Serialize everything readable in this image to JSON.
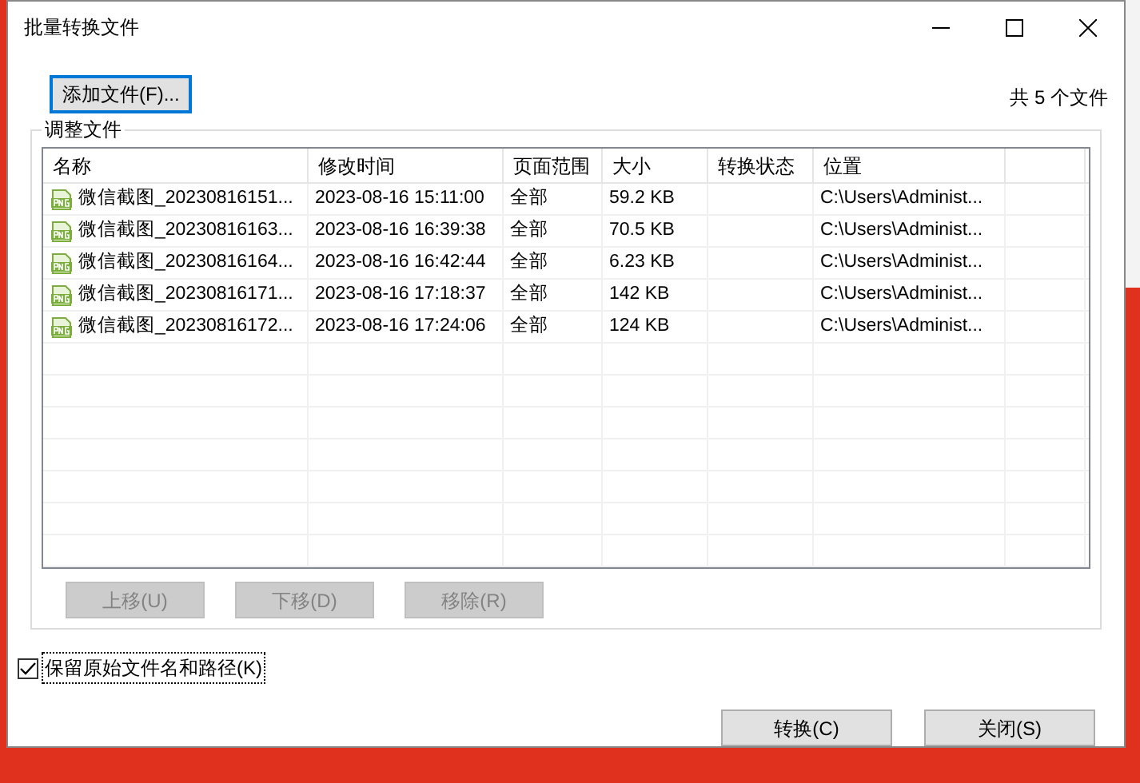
{
  "window": {
    "title": "批量转换文件"
  },
  "add_button": {
    "label": "添加文件(F)..."
  },
  "file_count": "共 5 个文件",
  "group": {
    "title": "调整文件"
  },
  "table": {
    "columns": [
      "名称",
      "修改时间",
      "页面范围",
      "大小",
      "转换状态",
      "位置"
    ],
    "rows": [
      {
        "name": "微信截图_20230816151...",
        "modified": "2023-08-16 15:11:00",
        "pages": "全部",
        "size": "59.2 KB",
        "location": "C:\\Users\\Administ..."
      },
      {
        "name": "微信截图_20230816163...",
        "modified": "2023-08-16 16:39:38",
        "pages": "全部",
        "size": "70.5 KB",
        "location": "C:\\Users\\Administ..."
      },
      {
        "name": "微信截图_20230816164...",
        "modified": "2023-08-16 16:42:44",
        "pages": "全部",
        "size": "6.23 KB",
        "location": "C:\\Users\\Administ..."
      },
      {
        "name": "微信截图_20230816171...",
        "modified": "2023-08-16 17:18:37",
        "pages": "全部",
        "size": "142 KB",
        "location": "C:\\Users\\Administ..."
      },
      {
        "name": "微信截图_20230816172...",
        "modified": "2023-08-16 17:24:06",
        "pages": "全部",
        "size": "124 KB",
        "location": "C:\\Users\\Administ..."
      }
    ]
  },
  "row_buttons": [
    {
      "label": "上移(U)",
      "disabled": true
    },
    {
      "label": "下移(D)",
      "disabled": true
    },
    {
      "label": "移除(R)",
      "disabled": true
    }
  ],
  "keep_original": {
    "label": "保留原始文件名和路径(K)",
    "checked": true
  },
  "footer_buttons": [
    {
      "label": "转换(C)",
      "disabled": false
    },
    {
      "label": "关闭(S)",
      "disabled": false
    }
  ]
}
